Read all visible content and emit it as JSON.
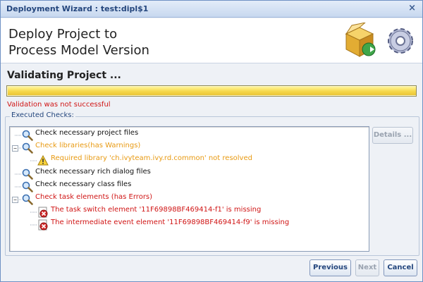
{
  "window": {
    "title": "Deployment Wizard : test:dipl$1",
    "close_label": "×"
  },
  "banner": {
    "heading_line1": "Deploy Project to",
    "heading_line2": "Process Model Version"
  },
  "status": {
    "title": "Validating Project ...",
    "progress_fraction": 1.0,
    "message": "Validation was not successful"
  },
  "checks": {
    "legend": "Executed Checks:",
    "details_label": "Details ...",
    "items": [
      {
        "label": "Check necessary project files",
        "level": 0,
        "status": "ok"
      },
      {
        "label": "Check libraries(has Warnings)",
        "level": 0,
        "status": "warning"
      },
      {
        "label": "Required library 'ch.ivyteam.ivy.rd.common' not resolved",
        "level": 1,
        "status": "warning"
      },
      {
        "label": "Check necessary rich dialog files",
        "level": 0,
        "status": "ok"
      },
      {
        "label": "Check necessary class files",
        "level": 0,
        "status": "ok"
      },
      {
        "label": "Check task elements (has Errors)",
        "level": 0,
        "status": "error"
      },
      {
        "label": "The task switch element '11F69898BF469414-f1' is missing",
        "level": 1,
        "status": "error"
      },
      {
        "label": "The intermediate event element '11F69898BF469414-f9' is missing",
        "level": 1,
        "status": "error"
      }
    ]
  },
  "footer": {
    "previous_label": "Previous",
    "next_label": "Next",
    "cancel_label": "Cancel"
  },
  "colors": {
    "error": "#d01515",
    "warning": "#e89a12",
    "accent": "#24467d"
  }
}
